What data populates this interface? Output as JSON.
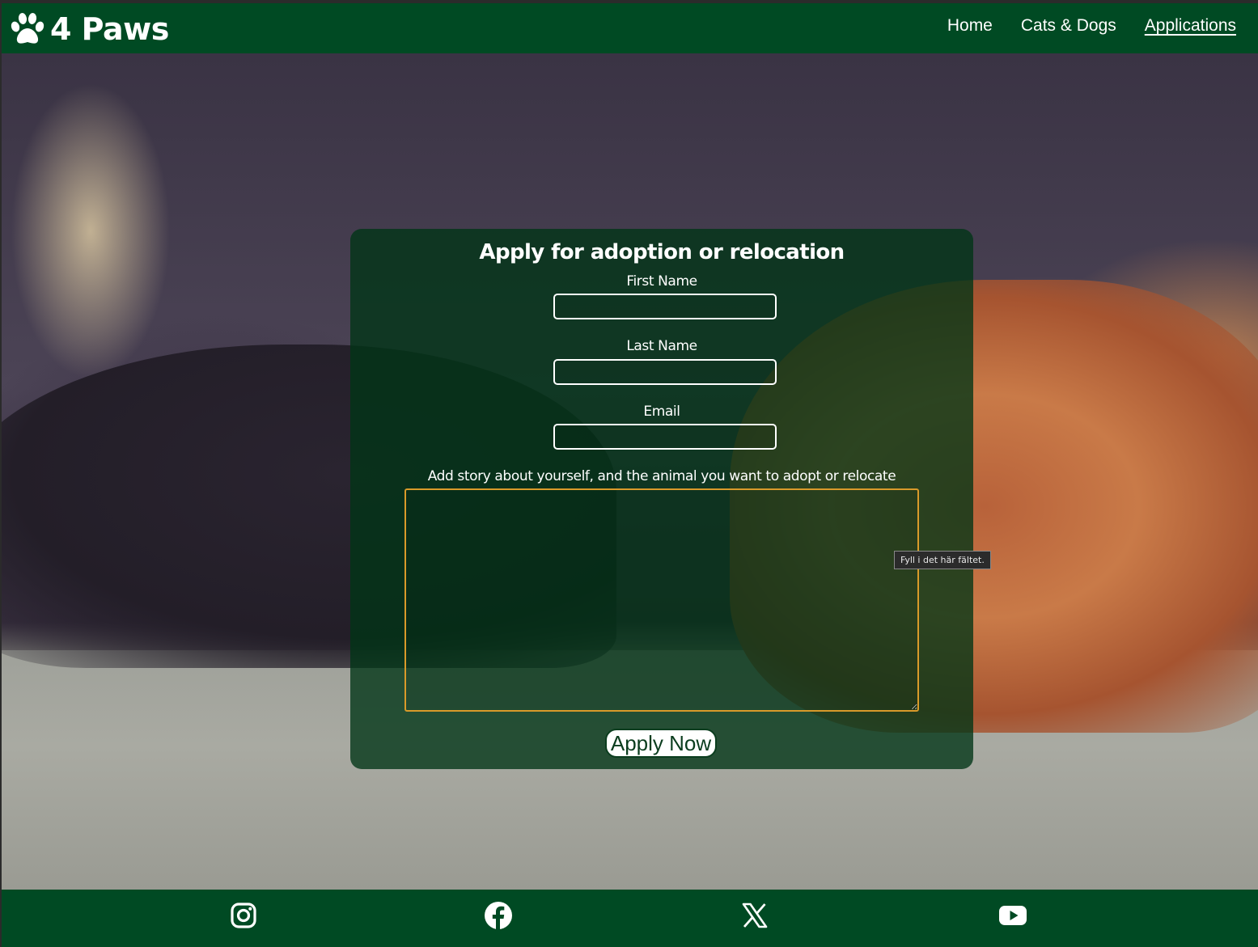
{
  "header": {
    "logo_text": "4 Paws",
    "logo_icon": "paw-icon",
    "nav": [
      {
        "label": "Home",
        "active": false
      },
      {
        "label": "Cats & Dogs",
        "active": false
      },
      {
        "label": "Applications",
        "active": true
      }
    ]
  },
  "form": {
    "title": "Apply for adoption or relocation",
    "first_name_label": "First Name",
    "first_name_value": "",
    "last_name_label": "Last Name",
    "last_name_value": "",
    "email_label": "Email",
    "email_value": "",
    "story_label": "Add story about yourself, and the animal you want to adopt or relocate",
    "story_value": "",
    "submit_label": "Apply Now",
    "validation_tooltip": "Fyll i det här fältet."
  },
  "footer": {
    "social": [
      "instagram-icon",
      "facebook-icon",
      "x-icon",
      "youtube-icon"
    ]
  },
  "colors": {
    "brand_green": "#004a23",
    "card_overlay": "#003416",
    "focus_outline": "#d99a2a"
  }
}
